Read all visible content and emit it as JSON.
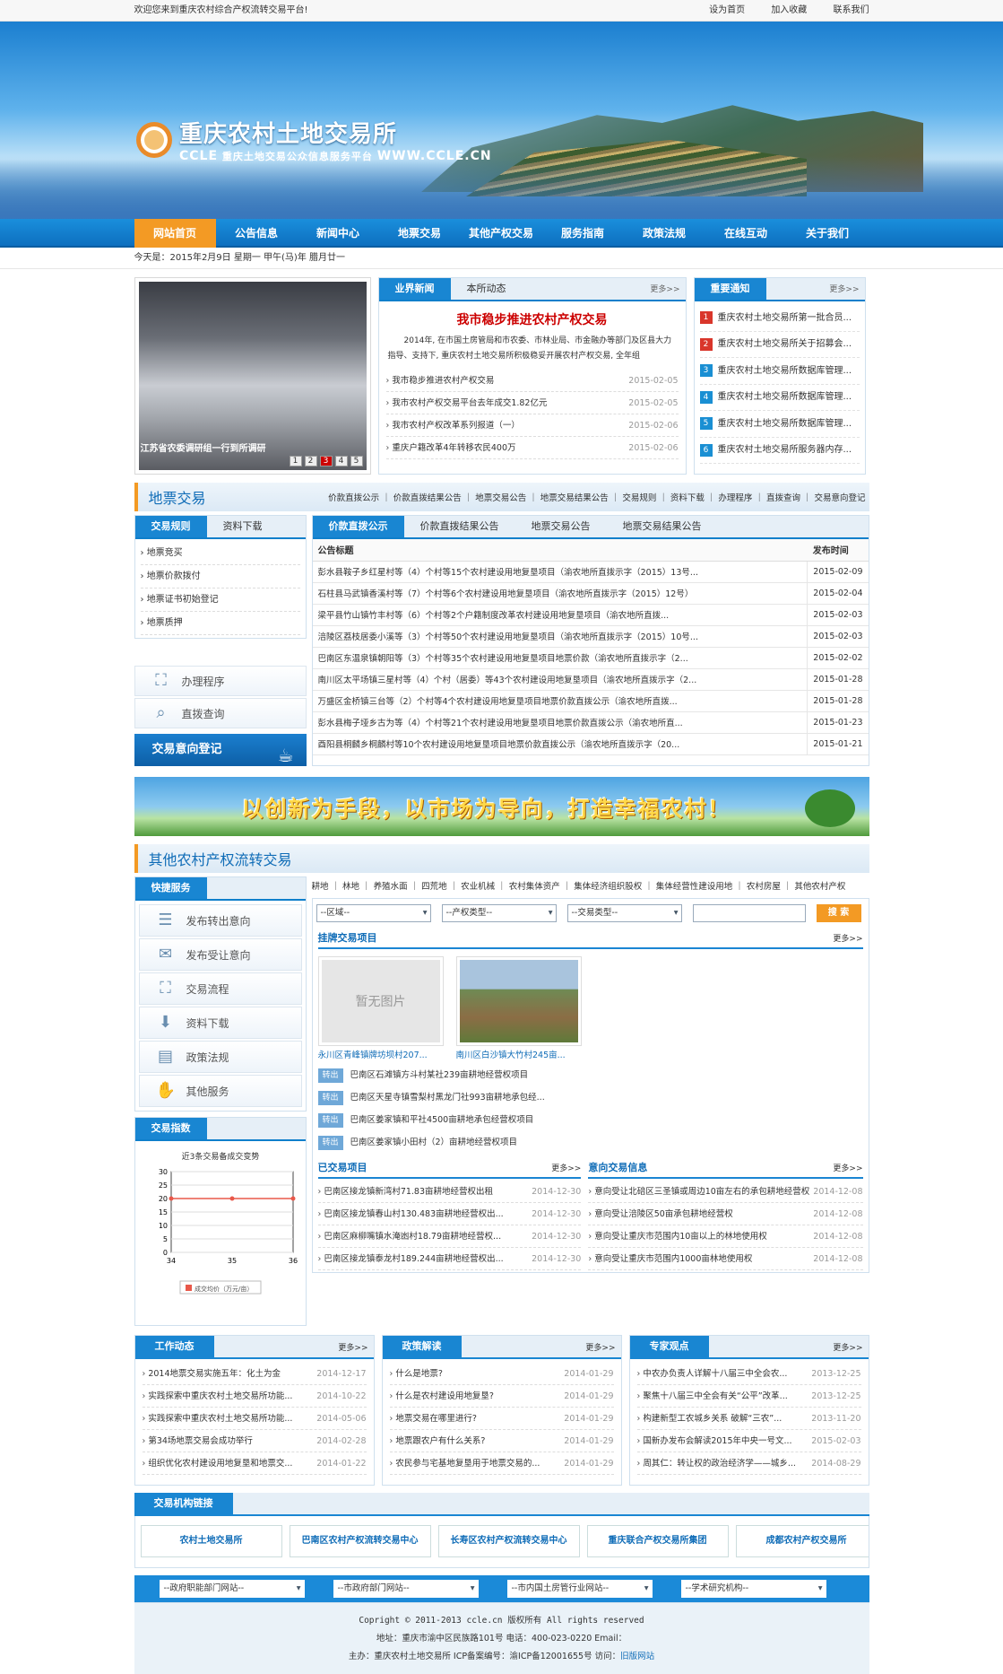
{
  "topbar": {
    "welcome": "欢迎您来到重庆农村综合产权流转交易平台!",
    "links": [
      "设为首页",
      "加入收藏",
      "联系我们"
    ]
  },
  "logo": {
    "name": "重庆农村土地交易所",
    "abbr": "CCLE",
    "subtitle": "重庆土地交易公众信息服务平台",
    "site": "WWW.CCLE.CN"
  },
  "nav": [
    "网站首页",
    "公告信息",
    "新闻中心",
    "地票交易",
    "其他产权交易",
    "服务指南",
    "政策法规",
    "在线互动",
    "关于我们"
  ],
  "date": "今天是：2015年2月9日 星期一 甲午(马)年 腊月廿一",
  "photo": {
    "caption": "江苏省农委调研组一行到所调研",
    "pages": [
      "1",
      "2",
      "3",
      "4",
      "5"
    ],
    "active": 2
  },
  "news": {
    "tabs": [
      "业界新闻",
      "本所动态"
    ],
    "more": "更多>>",
    "headline": "我市稳步推进农村产权交易",
    "summary": "2014年, 在市国土房管局和市农委、市林业局、市金融办等部门及区县大力指导、支持下, 重庆农村土地交易所积极稳妥开展农村产权交易, 全年组",
    "items": [
      {
        "t": "我市稳步推进农村产权交易",
        "d": "2015-02-05"
      },
      {
        "t": "我市农村产权交易平台去年成交1.82亿元",
        "d": "2015-02-05"
      },
      {
        "t": "我市农村产权改革系列报道（一）",
        "d": "2015-02-06"
      },
      {
        "t": "重庆户籍改革4年转移农民400万",
        "d": "2015-02-06"
      }
    ]
  },
  "notice": {
    "title": "重要通知",
    "more": "更多>>",
    "items": [
      "重庆农村土地交易所第一批合员...",
      "重庆农村土地交易所关于招募会...",
      "重庆农村土地交易所数据库管理...",
      "重庆农村土地交易所数据库管理...",
      "重庆农村土地交易所数据库管理...",
      "重庆农村土地交易所服务器内存..."
    ],
    "colors": [
      "#d9362b",
      "#d9362b",
      "#1a8fd3",
      "#1a8fd3",
      "#1a8fd3",
      "#1a8fd3"
    ]
  },
  "dipiao": {
    "title": "地票交易",
    "links": "价款直拨公示 ｜ 价款直拨结果公告 ｜ 地票交易公告 ｜ 地票交易结果公告 ｜ 交易规则 ｜ 资料下载 ｜ 办理程序 ｜ 直拨查询 ｜ 交易意向登记",
    "leftTabs": [
      "交易规则",
      "资料下载"
    ],
    "rules": [
      "地票竞买",
      "地票价款拨付",
      "地票证书初始登记",
      "地票质押"
    ],
    "btn1": "办理程序",
    "btn2": "直拨查询",
    "register": "交易意向登记",
    "tabs": [
      "价款直拨公示",
      "价款直拨结果公告",
      "地票交易公告",
      "地票交易结果公告"
    ],
    "th": [
      "公告标题",
      "发布时间"
    ],
    "rows": [
      [
        "彭水县鞍子乡红星村等（4）个村等15个农村建设用地复垦项目（渝农地所直拨示字（2015）13号...",
        "2015-02-09"
      ],
      [
        "石柱县马武镇香溪村等（7）个村等6个农村建设用地复垦项目（渝农地所直拨示字（2015）12号）",
        "2015-02-04"
      ],
      [
        "梁平县竹山镇竹丰村等（6）个村等2个户籍制度改革农村建设用地复垦项目（渝农地所直拨...",
        "2015-02-03"
      ],
      [
        "涪陵区荔枝居委小溪等（3）个村等50个农村建设用地复垦项目（渝农地所直拨示字（2015）10号...",
        "2015-02-03"
      ],
      [
        "巴南区东温泉镇朝阳等（3）个村等35个农村建设用地复垦项目地票价款（渝农地所直拨示字（2...",
        "2015-02-02"
      ],
      [
        "南川区太平场镇三星村等（4）个村（居委）等43个农村建设用地复垦项目（渝农地所直拨示字（2...",
        "2015-01-28"
      ],
      [
        "万盛区金桥镇三台等（2）个村等4个农村建设用地复垦项目地票价款直拨公示（渝农地所直拨...",
        "2015-01-28"
      ],
      [
        "彭水县梅子垭乡古为等（4）个村等21个农村建设用地复垦项目地票价款直拨公示（渝农地所直...",
        "2015-01-23"
      ],
      [
        "酉阳县桐麟乡桐麟村等10个农村建设用地复垦项目地票价款直拨公示（渝农地所直拨示字（20...",
        "2015-01-21"
      ]
    ]
  },
  "slogan": "以创新为手段，以市场为导向，打造幸福农村！",
  "other": {
    "title": "其他农村产权流转交易",
    "cats": "耕地 ｜ 林地 ｜ 养殖水面 ｜ 四荒地 ｜ 农业机械 ｜ 农村集体资产 ｜ 集体经济组织股权 ｜ 集体经营性建设用地 ｜ 农村房屋 ｜ 其他农村产权",
    "quick": "快捷服务",
    "quickItems": [
      "发布转出意向",
      "发布受让意向",
      "交易流程",
      "资料下载",
      "政策法规",
      "其他服务"
    ],
    "filters": [
      "--区域--",
      "--产权类型--",
      "--交易类型--"
    ],
    "search": "搜 索",
    "listTitle": "挂牌交易项目",
    "more": "更多>>",
    "pics": [
      "永川区青峰镇牌坊坝村207...",
      "南川区白沙镇大竹村245亩..."
    ],
    "noimg": "暂无图片",
    "outLabel": "转出",
    "outItems": [
      "巴南区石滩镇方斗村某社239亩耕地经营权项目",
      "巴南区天星寺镇雪梨村黑龙门社993亩耕地承包经...",
      "巴南区姜家镇和平社4500亩耕地承包经营权项目",
      "巴南区姜家镇小田村（2）亩耕地经营权项目"
    ],
    "doneTitle": "已交易项目",
    "intentTitle": "意向交易信息",
    "done": [
      {
        "t": "巴南区接龙镇新湾村71.83亩耕地经营权出租",
        "d": "2014-12-30"
      },
      {
        "t": "巴南区接龙镇春山村130.483亩耕地经营权出...",
        "d": "2014-12-30"
      },
      {
        "t": "巴南区麻柳嘴镇水淹凼村18.79亩耕地经营权...",
        "d": "2014-12-30"
      },
      {
        "t": "巴南区接龙镇泰龙村189.244亩耕地经营权出...",
        "d": "2014-12-30"
      }
    ],
    "intent": [
      {
        "t": "意向受让北碚区三圣镇或周边10亩左右的承包耕地经营权",
        "d": "2014-12-08"
      },
      {
        "t": "意向受让涪陵区50亩承包耕地经营权",
        "d": "2014-12-08"
      },
      {
        "t": "意向受让重庆市范围内10亩以上的林地使用权",
        "d": "2014-12-08"
      },
      {
        "t": "意向受让重庆市范围内1000亩林地使用权",
        "d": "2014-12-08"
      }
    ],
    "indexTitle": "交易指数"
  },
  "chart_data": {
    "type": "line",
    "title": "近3条交易备成交变势",
    "x": [
      "34",
      "35",
      "36"
    ],
    "ylim": [
      0,
      30
    ],
    "yticks": [
      0,
      5,
      10,
      15,
      20,
      25,
      30
    ],
    "series": [
      {
        "name": "成交均价（万元/亩）",
        "values": [
          20,
          20,
          20
        ]
      }
    ],
    "color": "#e8584a"
  },
  "bottom": [
    {
      "title": "工作动态",
      "more": "更多>>",
      "items": [
        {
          "t": "2014地票交易实施五年：化土为金",
          "d": "2014-12-17"
        },
        {
          "t": "实践探索中重庆农村土地交易所功能...",
          "d": "2014-10-22"
        },
        {
          "t": "实践探索中重庆农村土地交易所功能...",
          "d": "2014-05-06"
        },
        {
          "t": "第34场地票交易会成功举行",
          "d": "2014-02-28"
        },
        {
          "t": "组织优化农村建设用地复垦和地票交...",
          "d": "2014-01-22"
        }
      ]
    },
    {
      "title": "政策解读",
      "more": "更多>>",
      "items": [
        {
          "t": "什么是地票?",
          "d": "2014-01-29"
        },
        {
          "t": "什么是农村建设用地复垦?",
          "d": "2014-01-29"
        },
        {
          "t": "地票交易在哪里进行?",
          "d": "2014-01-29"
        },
        {
          "t": "地票跟农户有什么关系?",
          "d": "2014-01-29"
        },
        {
          "t": "农民参与宅基地复垦用于地票交易的...",
          "d": "2014-01-29"
        }
      ]
    },
    {
      "title": "专家观点",
      "more": "更多>>",
      "items": [
        {
          "t": "中农办负责人详解十八届三中全会农...",
          "d": "2013-12-25"
        },
        {
          "t": "聚焦十八届三中全会有关“公平”改革...",
          "d": "2013-12-25"
        },
        {
          "t": "构建新型工农城乡关系 破解“三农”...",
          "d": "2013-11-20"
        },
        {
          "t": "国新办发布会解读2015年中央一号文...",
          "d": "2015-02-03"
        },
        {
          "t": "周其仁：转让权的政治经济学——城乡...",
          "d": "2014-08-29"
        }
      ]
    }
  ],
  "links": {
    "title": "交易机构链接",
    "items": [
      "农村土地交易所",
      "巴南区农村产权流转交易中心",
      "长寿区农村产权流转交易中心",
      "重庆联合产权交易所集团",
      "成都农村产权交易所"
    ]
  },
  "selects": [
    "--政府职能部门网站--",
    "--市政府部门网站--",
    "--市内国土房管行业网站--",
    "--学术研究机构--"
  ],
  "footer": {
    "copy": "Copright © 2011-2013 ccle.cn 版权所有 All rights reserved",
    "addr": "地址：重庆市渝中区民族路101号 电话：400-023-0220 Email：",
    "host": "主办：重庆农村土地交易所 ICP备案编号：渝ICP备12001655号 访问：",
    "old": "旧版网站"
  }
}
